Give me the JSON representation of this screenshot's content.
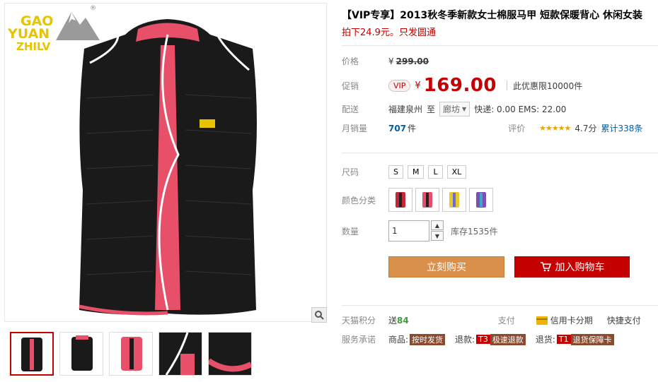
{
  "brand": {
    "line1": "GAO",
    "line2": "YUAN",
    "line3": "ZHILV",
    "reg": "®"
  },
  "product": {
    "title": "【VIP专享】2013秋冬季新款女士棉服马甲 短款保暖背心 休闲女装",
    "subtitle": "拍下24.9元。只发圆通"
  },
  "price": {
    "label": "价格",
    "currency": "¥",
    "original": "299.00"
  },
  "promo": {
    "label": "促销",
    "badge": "VIP",
    "currency": "¥",
    "value": "169.00",
    "limit": "此优惠限10000件"
  },
  "shipping": {
    "label": "配送",
    "from": "福建泉州",
    "to_word": "至",
    "to": "廊坊",
    "fees": "快递: 0.00 EMS: 22.00"
  },
  "sales": {
    "label": "月销量",
    "count": "707",
    "unit": "件",
    "rating_label": "评价",
    "stars": "★★★★★",
    "score": "4.7分",
    "reviews": "累计338条"
  },
  "options": {
    "size_label": "尺码",
    "sizes": [
      "S",
      "M",
      "L",
      "XL"
    ],
    "color_label": "颜色分类",
    "colors": [
      "#c4273a",
      "#e84d6a",
      "#e8c82c",
      "#7b4fb5"
    ]
  },
  "quantity": {
    "label": "数量",
    "value": "1",
    "stock": "库存1535件"
  },
  "buttons": {
    "buy": "立刻购买",
    "cart": "加入购物车"
  },
  "points": {
    "label": "天猫积分",
    "prefix": "送",
    "value": "84",
    "pay_label": "支付",
    "credit": "信用卡分期",
    "quick": "快捷支付"
  },
  "service": {
    "label": "服务承诺",
    "item1_prefix": "商品:",
    "item1_tag": "按时发货",
    "item2_prefix": "退款:",
    "item2_code": "T3",
    "item2_tag": "极速退款",
    "item3_prefix": "退货:",
    "item3_code": "T1",
    "item3_tag": "退货保障卡"
  },
  "icons": {
    "zoom": "zoom-icon",
    "cart": "cart-icon",
    "credit_card": "credit-card-icon"
  },
  "colors": {
    "accent": "#c40000",
    "buy_button": "#d9904a",
    "logo": "#e8c400"
  }
}
